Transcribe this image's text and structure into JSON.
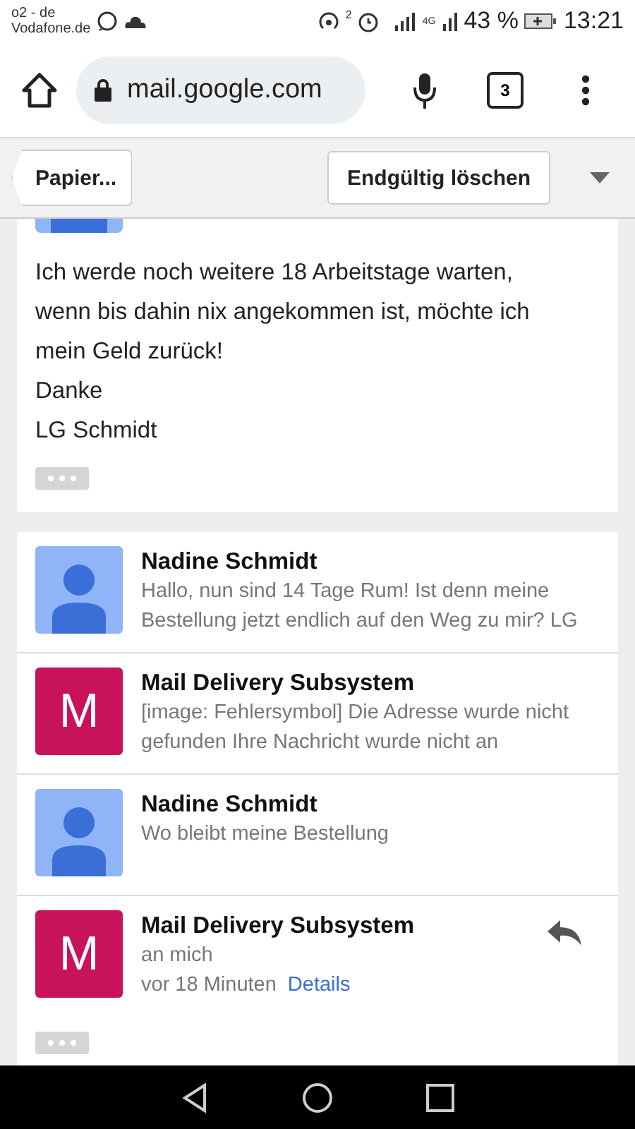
{
  "status_bar": {
    "carrier": [
      "o2 - de",
      "Vodafone.de"
    ],
    "hotspot_count": "2",
    "network": "4G",
    "battery": "43 %",
    "time": "13:21"
  },
  "browser": {
    "url": "mail.google.com",
    "tab_count": "3"
  },
  "toolbar": {
    "back_label": "Papier...",
    "delete_button": "Endgültig löschen"
  },
  "open_message": {
    "body": [
      "Ich werde noch weitere 18 Arbeitstage warten, wenn bis dahin nix angekommen ist, möchte ich mein Geld zurück!",
      "Danke",
      "LG Schmidt"
    ]
  },
  "thread": [
    {
      "kind": "collapsed",
      "avatar": {
        "kind": "person"
      },
      "sender": "Nadine Schmidt",
      "snippet": "Hallo, nun sind 14 Tage Rum! Ist denn meine Bestellung jetzt endlich auf den Weg zu mir? LG"
    },
    {
      "kind": "collapsed",
      "avatar": {
        "kind": "letter",
        "letter": "M",
        "color": "#c8125c"
      },
      "sender": "Mail Delivery Subsystem",
      "snippet": "[image: Fehlersymbol] Die Adresse wurde nicht gefunden Ihre Nachricht wurde nicht an"
    },
    {
      "kind": "collapsed",
      "avatar": {
        "kind": "person"
      },
      "sender": "Nadine Schmidt",
      "snippet": "Wo bleibt meine Bestellung"
    },
    {
      "kind": "expanded",
      "avatar": {
        "kind": "letter",
        "letter": "M",
        "color": "#c8125c"
      },
      "sender": "Mail Delivery Subsystem",
      "recipient": "an mich",
      "time": "vor 18 Minuten",
      "details_link": "Details"
    }
  ]
}
